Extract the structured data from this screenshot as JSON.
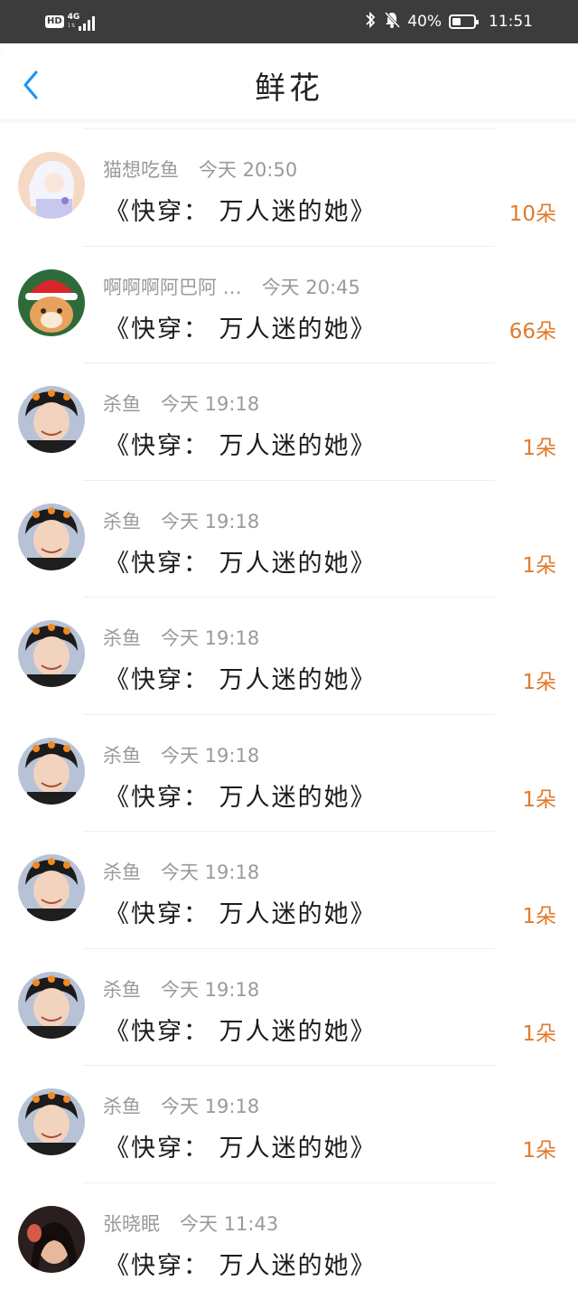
{
  "status_bar": {
    "hd": "HD",
    "network": "4G",
    "network_sub": "1⇅",
    "battery_text": "40%",
    "battery_level": 0.4,
    "time": "11:51",
    "icons": [
      "bluetooth-icon",
      "mute-bell-icon",
      "battery-icon"
    ]
  },
  "nav": {
    "title": "鲜花",
    "back_icon": "chevron-left-icon",
    "accent": "#2196f3"
  },
  "colors": {
    "flower_count": "#e07a2b",
    "meta": "#9a9a9a"
  },
  "records": [
    {
      "name": "猫想吃鱼",
      "time": "今天 20:50",
      "book": "《快穿： 万人迷的她》",
      "flowers": "10朵",
      "avatar": "anime-girl-avatar"
    },
    {
      "name": "啊啊啊阿巴阿 …",
      "time": "今天 20:45",
      "book": "《快穿： 万人迷的她》",
      "flowers": "66朵",
      "avatar": "cat-santa-avatar"
    },
    {
      "name": "杀鱼",
      "time": "今天 19:18",
      "book": "《快穿： 万人迷的她》",
      "flowers": "1朵",
      "avatar": "boy-photo-avatar"
    },
    {
      "name": "杀鱼",
      "time": "今天 19:18",
      "book": "《快穿： 万人迷的她》",
      "flowers": "1朵",
      "avatar": "boy-photo-avatar"
    },
    {
      "name": "杀鱼",
      "time": "今天 19:18",
      "book": "《快穿： 万人迷的她》",
      "flowers": "1朵",
      "avatar": "boy-photo-avatar"
    },
    {
      "name": "杀鱼",
      "time": "今天 19:18",
      "book": "《快穿： 万人迷的她》",
      "flowers": "1朵",
      "avatar": "boy-photo-avatar"
    },
    {
      "name": "杀鱼",
      "time": "今天 19:18",
      "book": "《快穿： 万人迷的她》",
      "flowers": "1朵",
      "avatar": "boy-photo-avatar"
    },
    {
      "name": "杀鱼",
      "time": "今天 19:18",
      "book": "《快穿： 万人迷的她》",
      "flowers": "1朵",
      "avatar": "boy-photo-avatar"
    },
    {
      "name": "杀鱼",
      "time": "今天 19:18",
      "book": "《快穿： 万人迷的她》",
      "flowers": "1朵",
      "avatar": "boy-photo-avatar"
    },
    {
      "name": "张晓眠",
      "time": "今天 11:43",
      "book": "《快穿： 万人迷的她》",
      "flowers": "",
      "avatar": "girl-photo-avatar"
    }
  ]
}
